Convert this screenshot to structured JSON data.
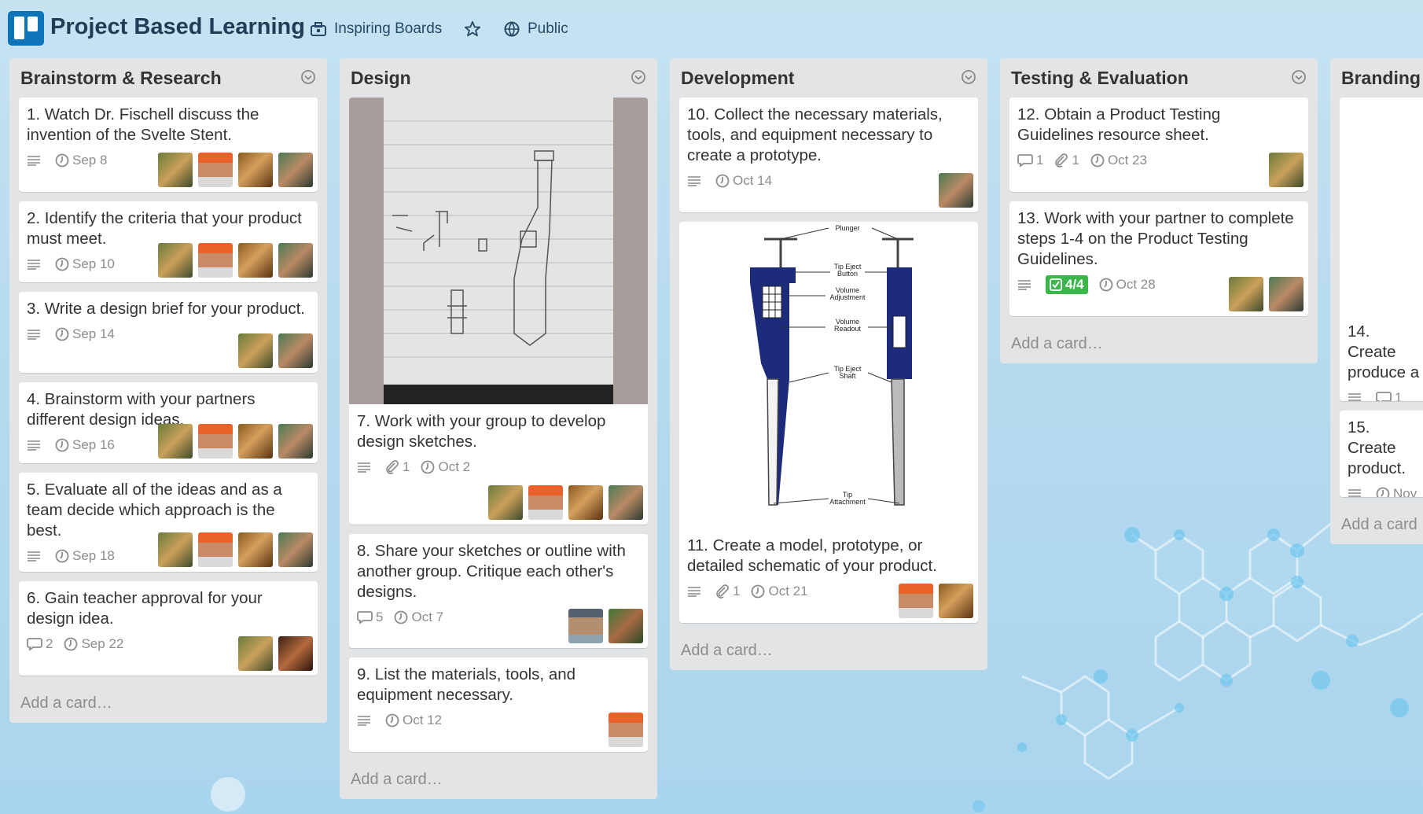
{
  "board": {
    "title": "Project Based Learning",
    "team": "Inspiring Boards",
    "visibility": "Public"
  },
  "lists": [
    {
      "title": "Brainstorm & Research",
      "add_card": "Add a card…",
      "cards": [
        {
          "title": "1. Watch Dr. Fischell discuss the invention of the Svelte Stent.",
          "due": "Sep 8"
        },
        {
          "title": "2. Identify the criteria that your product must meet.",
          "due": "Sep 10"
        },
        {
          "title": "3. Write a design brief for your product.",
          "due": "Sep 14"
        },
        {
          "title": "4. Brainstorm with your partners different design ideas.",
          "due": "Sep 16"
        },
        {
          "title": "5. Evaluate all of the ideas and as a team decide which approach is the best.",
          "due": "Sep 18"
        },
        {
          "title": "6. Gain teacher approval for your design idea.",
          "comments": "2",
          "due": "Sep 22"
        }
      ]
    },
    {
      "title": "Design",
      "add_card": "Add a card…",
      "cards": [
        {
          "title": "7. Work with your group to develop design sketches.",
          "attachments": "1",
          "due": "Oct 2"
        },
        {
          "title": "8. Share your sketches or outline with another group. Critique each other's designs.",
          "comments": "5",
          "due": "Oct 7"
        },
        {
          "title": "9. List the materials, tools, and equipment necessary.",
          "due": "Oct 12"
        }
      ]
    },
    {
      "title": "Development",
      "add_card": "Add a card…",
      "cards": [
        {
          "title": "10. Collect the necessary materials, tools, and equipment necessary to create a prototype.",
          "due": "Oct 14"
        },
        {
          "title": "11. Create a model, prototype, or detailed schematic of your product.",
          "attachments": "1",
          "due": "Oct 21"
        }
      ],
      "diagram_labels": [
        "Plunger",
        "Tip Eject",
        "Button",
        "Volume",
        "Adjustment",
        "Volume",
        "Readout",
        "Tip Eject",
        "Shaft",
        "Tip",
        "Attachment"
      ]
    },
    {
      "title": "Testing & Evaluation",
      "add_card": "Add a card…",
      "cards": [
        {
          "title": "12. Obtain a Product Testing Guidelines resource sheet.",
          "comments": "1",
          "attachments": "1",
          "due": "Oct 23"
        },
        {
          "title": "13. Work with your partner to complete steps 1-4 on the Product Testing Guidelines.",
          "checklist": "4/4",
          "due": "Oct 28"
        }
      ]
    },
    {
      "title": "Branding",
      "add_card": "Add a card",
      "cards": [
        {
          "title": "14. Create produce a",
          "comments": "1"
        },
        {
          "title": "15. Create product.",
          "due": "Nov"
        }
      ]
    }
  ],
  "colors": {
    "list_bg": "#e2e4e6",
    "card_bg": "#ffffff",
    "logo_blue": "#0e74b8",
    "checklist_green": "#3bb64b"
  },
  "icons": [
    "board-logo-icon",
    "team-icon",
    "star-icon",
    "globe-icon",
    "list-menu-icon",
    "description-icon",
    "clock-icon",
    "comment-icon",
    "attachment-icon",
    "checklist-icon"
  ]
}
